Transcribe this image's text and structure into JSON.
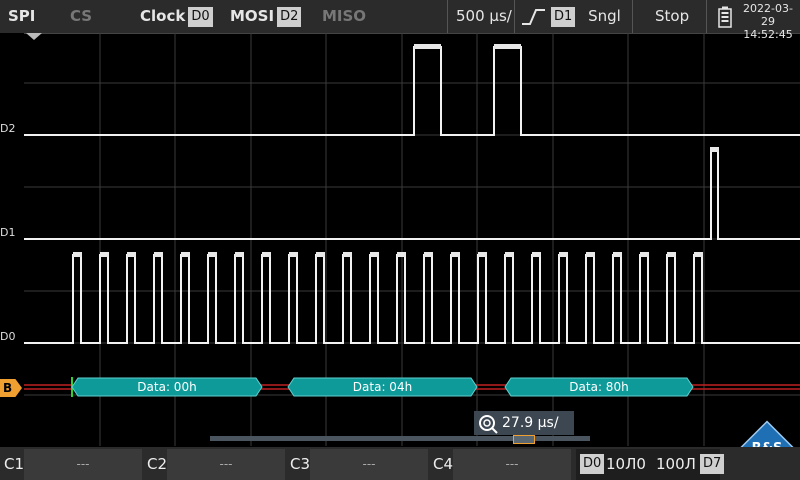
{
  "topbar": {
    "protocol": "SPI",
    "cs_label": "CS",
    "clock_label": "Clock",
    "clock_source": "D0",
    "mosi_label": "MOSI",
    "mosi_source": "D2",
    "miso_label": "MISO",
    "timebase": "500 µs/",
    "trigger_source": "D1",
    "trigger_mode": "Sngl",
    "run_state": "Stop",
    "date": "2022-03-29",
    "time": "14:52:45"
  },
  "channels": {
    "d2": "D2",
    "d1": "D1",
    "d0": "D0",
    "bus": "B"
  },
  "bus_frames": [
    "Data: 00h",
    "Data: 04h",
    "Data: 80h"
  ],
  "zoom": {
    "value": "27.9 µs/"
  },
  "bottombar": {
    "c1": "C1",
    "c1_val": "---",
    "c2": "C2",
    "c2_val": "---",
    "c3": "C3",
    "c3_val": "---",
    "c4": "C4",
    "c4_val": "---",
    "logic_start": "D0",
    "logic_end": "D7",
    "logic_pattern_a": "10Л0",
    "logic_pattern_b": "100Л"
  },
  "colors": {
    "bus": "#0f9a9a",
    "bus_label": "#f0a030",
    "grid": "#3a3a3a"
  }
}
